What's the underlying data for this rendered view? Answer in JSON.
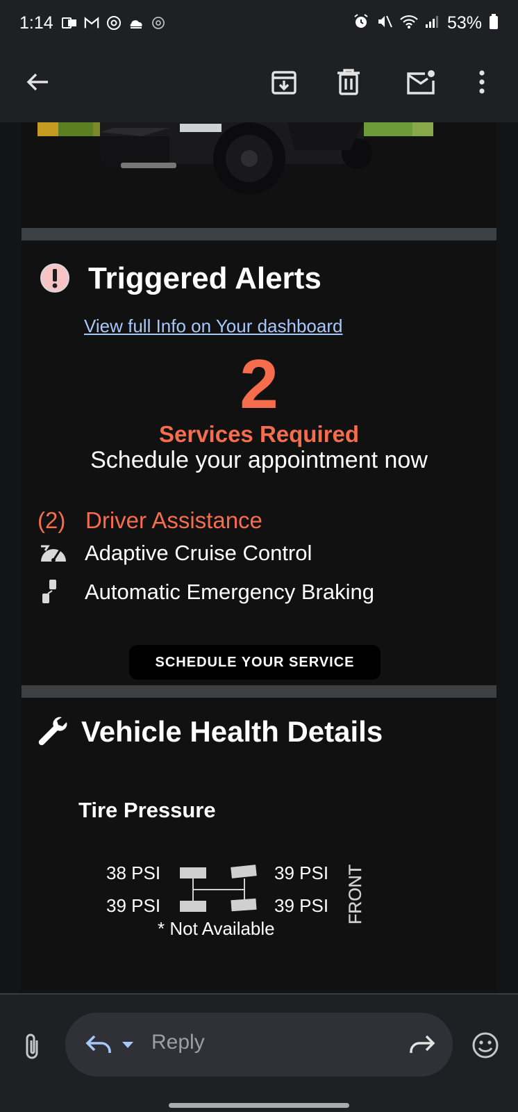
{
  "status_bar": {
    "time": "1:14",
    "battery_percent": "53%"
  },
  "toolbar": {
    "icons": [
      "back-arrow-icon",
      "archive-icon",
      "delete-icon",
      "mark-unread-icon",
      "more-vert-icon"
    ]
  },
  "alerts": {
    "title": "Triggered Alerts",
    "dashboard_link": "View full Info on Your dashboard",
    "count": "2",
    "services_required": "Services Required",
    "schedule_text": "Schedule your appointment now",
    "category_count": "(2)",
    "category_label": "Driver Assistance",
    "features": [
      {
        "label": "Adaptive Cruise Control",
        "icon": "speedometer-icon"
      },
      {
        "label": "Automatic Emergency Braking",
        "icon": "collision-icon"
      }
    ],
    "button_label": "SCHEDULE YOUR SERVICE"
  },
  "health": {
    "title": "Vehicle Health Details",
    "tire_title": "Tire Pressure",
    "psi": {
      "front_left": "38 PSI",
      "rear_left": "39 PSI",
      "front_right": "39 PSI",
      "rear_right": "39 PSI"
    },
    "front_label": "FRONT",
    "not_available": "* Not Available"
  },
  "reply_bar": {
    "placeholder": "Reply"
  },
  "colors": {
    "accent_orange": "#f56d4c",
    "link_blue": "#a8c7fa",
    "background": "#1f2023"
  }
}
